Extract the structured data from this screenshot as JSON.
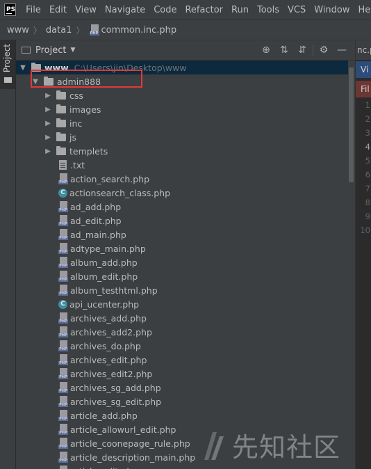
{
  "menu": [
    "File",
    "Edit",
    "View",
    "Navigate",
    "Code",
    "Refactor",
    "Run",
    "Tools",
    "VCS",
    "Window",
    "Help"
  ],
  "app_logo": "PS",
  "breadcrumb": {
    "root": "www",
    "folder": "data1",
    "file": "common.inc.php"
  },
  "left_strip": {
    "tab_label": "Project"
  },
  "pane": {
    "title": "Project"
  },
  "tree": {
    "root": {
      "name": "www",
      "path": "C:\\Users\\jin\\Desktop\\www"
    },
    "selected_folder": "admin888",
    "folders": [
      "css",
      "images",
      "inc",
      "js",
      "templets"
    ],
    "files": [
      {
        "name": ".txt",
        "icon": "txt"
      },
      {
        "name": "action_search.php",
        "icon": "php"
      },
      {
        "name": "actionsearch_class.php",
        "icon": "class"
      },
      {
        "name": "ad_add.php",
        "icon": "php"
      },
      {
        "name": "ad_edit.php",
        "icon": "php"
      },
      {
        "name": "ad_main.php",
        "icon": "php"
      },
      {
        "name": "adtype_main.php",
        "icon": "php"
      },
      {
        "name": "album_add.php",
        "icon": "php"
      },
      {
        "name": "album_edit.php",
        "icon": "php"
      },
      {
        "name": "album_testhtml.php",
        "icon": "php"
      },
      {
        "name": "api_ucenter.php",
        "icon": "class"
      },
      {
        "name": "archives_add.php",
        "icon": "php"
      },
      {
        "name": "archives_add2.php",
        "icon": "php"
      },
      {
        "name": "archives_do.php",
        "icon": "php"
      },
      {
        "name": "archives_edit.php",
        "icon": "php"
      },
      {
        "name": "archives_edit2.php",
        "icon": "php"
      },
      {
        "name": "archives_sg_add.php",
        "icon": "php"
      },
      {
        "name": "archives_sg_edit.php",
        "icon": "php"
      },
      {
        "name": "article_add.php",
        "icon": "php"
      },
      {
        "name": "article_allowurl_edit.php",
        "icon": "php"
      },
      {
        "name": "article_coonepage_rule.php",
        "icon": "php"
      },
      {
        "name": "article_description_main.php",
        "icon": "php"
      },
      {
        "name": "article_edit.php",
        "icon": "php"
      }
    ]
  },
  "editor": {
    "tab": "nc.p",
    "banner_vi": "Vi",
    "banner_fi": "Fil",
    "line_numbers": [
      "1",
      "2",
      "3",
      "4",
      "5",
      "6",
      "7",
      "8",
      "9",
      "10"
    ],
    "current_line": "4"
  },
  "watermark": {
    "text": "先知社区"
  }
}
